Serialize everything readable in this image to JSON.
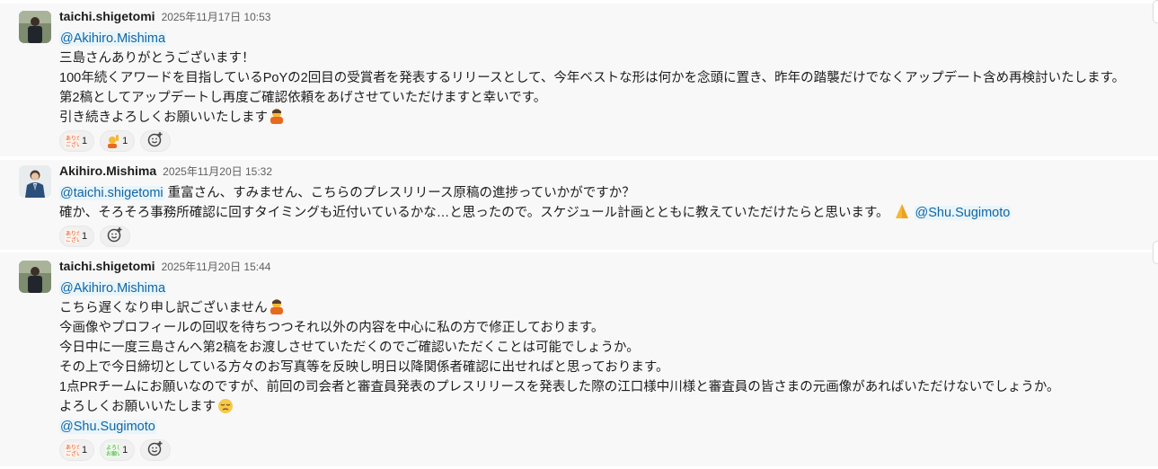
{
  "messages": [
    {
      "author": "taichi.shigetomi",
      "timestamp": "2025年11月17日 10:53",
      "lines": [
        {
          "mention": "@Akihiro.Mishima"
        },
        {
          "text": "三島さんありがとうございます！"
        },
        {
          "text": "100年続くアワードを目指しているPoYの2回目の受賞者を発表するリリースとして、今年ベストな形は何かを念頭に置き、昨年の踏襲だけでなくアップデート含め再検討いたします。"
        },
        {
          "text": "第2稿としてアップデートし再度ご確認依頼をあげさせていただけますと幸いです。"
        },
        {
          "text": "引き続きよろしくお願いいたします",
          "emoji": "person-bowing"
        }
      ],
      "reactions": [
        {
          "emoji": "arigatou-gozaimasu-stamp",
          "count": "1"
        },
        {
          "emoji": "person-raising-hand",
          "count": "1"
        }
      ]
    },
    {
      "author": "Akihiro.Mishima",
      "timestamp": "2025年11月20日 15:32",
      "lines": [
        {
          "mention": "@taichi.shigetomi",
          "text": " 重富さん、すみません、こちらのプレスリリース原稿の進捗っていかがですか？"
        },
        {
          "text": "確か、そろそろ事務所確認に回すタイミングも近付いているかな…と思ったので。スケジュール計画とともに教えていただけたらと思います。",
          "emoji": "folded-hands",
          "mention_after": "@Shu.Sugimoto"
        }
      ],
      "reactions": [
        {
          "emoji": "arigatou-gozaimasu-stamp",
          "count": "1"
        }
      ]
    },
    {
      "author": "taichi.shigetomi",
      "timestamp": "2025年11月20日 15:44",
      "lines": [
        {
          "mention": "@Akihiro.Mishima"
        },
        {
          "text": "こちら遅くなり申し訳ございません",
          "emoji": "person-bowing"
        },
        {
          "text": "今画像やプロフィールの回収を待ちつつそれ以外の内容を中心に私の方で修正しております。"
        },
        {
          "text": "今日中に一度三島さんへ第2稿をお渡しさせていただくのでご確認いただくことは可能でしょうか。"
        },
        {
          "text": "その上で今日締切としている方々のお写真等を反映し明日以降関係者確認に出せればと思っております。"
        },
        {
          "text": "1点PRチームにお願いなのですが、前回の司会者と審査員発表のプレスリリースを発表した際の江口様中川様と審査員の皆さまの元画像があればいただけないでしょうか。"
        },
        {
          "text": "よろしくお願いいたします",
          "emoji": "pleading-face"
        },
        {
          "mention": "@Shu.Sugimoto"
        }
      ],
      "reactions": [
        {
          "emoji": "arigatou-gozaimasu-stamp",
          "count": "1"
        },
        {
          "emoji": "yoroshiku-onegaishimasu-stamp",
          "count": "1"
        }
      ]
    }
  ]
}
